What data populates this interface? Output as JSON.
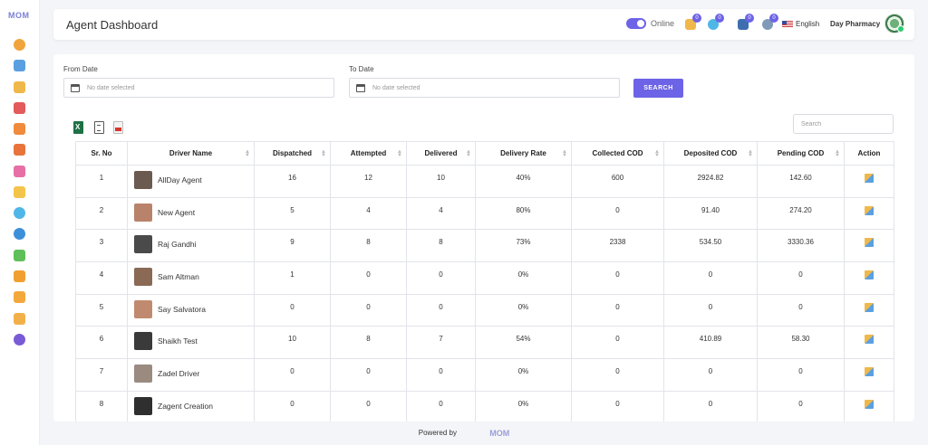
{
  "brand": "MOM",
  "sidebar": {
    "icons": [
      {
        "name": "dashboard-gauge-icon",
        "color": "#f1a43c"
      },
      {
        "name": "monitor-icon",
        "color": "#5aa0e0"
      },
      {
        "name": "box-icon",
        "color": "#f0b84a"
      },
      {
        "name": "ticket-icon",
        "color": "#e35b5b"
      },
      {
        "name": "hierarchy-icon",
        "color": "#f08a3c"
      },
      {
        "name": "agent-search-icon",
        "color": "#e8743b"
      },
      {
        "name": "grid-apps-icon",
        "color": "#e66fa6"
      },
      {
        "name": "table-icon",
        "color": "#f3c34a"
      },
      {
        "name": "chat-icon",
        "color": "#4fb6e8"
      },
      {
        "name": "globe-icon",
        "color": "#3d8fd9"
      },
      {
        "name": "wallet-icon",
        "color": "#5fbf5a"
      },
      {
        "name": "cart-icon",
        "color": "#f0a030"
      },
      {
        "name": "user-stack-icon",
        "color": "#f3a83c"
      },
      {
        "name": "package-icon",
        "color": "#f2b04a"
      },
      {
        "name": "globe-alt-icon",
        "color": "#7a5bd6"
      }
    ]
  },
  "header": {
    "title": "Agent Dashboard",
    "status_label": "Online",
    "badges": {
      "notifications": "0",
      "messages": "0",
      "orders": "0",
      "settings": "0"
    },
    "language": "English",
    "pharmacy": "Day Pharmacy",
    "accent": "#6c63e6"
  },
  "filters": {
    "from_label": "From Date",
    "to_label": "To Date",
    "from_placeholder": "No date selected",
    "to_placeholder": "No date selected",
    "search_button": "SEARCH",
    "table_search_placeholder": "Search"
  },
  "table": {
    "headers": [
      "Sr. No",
      "Driver Name",
      "Dispatched",
      "Attempted",
      "Delivered",
      "Delivery Rate",
      "Collected COD",
      "Deposited COD",
      "Pending COD",
      "Action"
    ],
    "rows": [
      {
        "sr": "1",
        "driver": "AllDay Agent",
        "dispatched": "16",
        "attempted": "12",
        "delivered": "10",
        "rate": "40%",
        "collected": "600",
        "deposited": "2924.82",
        "pending": "142.60",
        "avatar_color": "#6b5a50"
      },
      {
        "sr": "2",
        "driver": "New Agent",
        "dispatched": "5",
        "attempted": "4",
        "delivered": "4",
        "rate": "80%",
        "collected": "0",
        "deposited": "91.40",
        "pending": "274.20",
        "avatar_color": "#b9826a"
      },
      {
        "sr": "3",
        "driver": "Raj Gandhi",
        "dispatched": "9",
        "attempted": "8",
        "delivered": "8",
        "rate": "73%",
        "collected": "2338",
        "deposited": "534.50",
        "pending": "3330.36",
        "avatar_color": "#4a4a4a"
      },
      {
        "sr": "4",
        "driver": "Sam Altman",
        "dispatched": "1",
        "attempted": "0",
        "delivered": "0",
        "rate": "0%",
        "collected": "0",
        "deposited": "0",
        "pending": "0",
        "avatar_color": "#8a6a55"
      },
      {
        "sr": "5",
        "driver": "Say Salvatora",
        "dispatched": "0",
        "attempted": "0",
        "delivered": "0",
        "rate": "0%",
        "collected": "0",
        "deposited": "0",
        "pending": "0",
        "avatar_color": "#c08a70"
      },
      {
        "sr": "6",
        "driver": "Shaikh Test",
        "dispatched": "10",
        "attempted": "8",
        "delivered": "7",
        "rate": "54%",
        "collected": "0",
        "deposited": "410.89",
        "pending": "58.30",
        "avatar_color": "#3a3a3a"
      },
      {
        "sr": "7",
        "driver": "Zadel Driver",
        "dispatched": "0",
        "attempted": "0",
        "delivered": "0",
        "rate": "0%",
        "collected": "0",
        "deposited": "0",
        "pending": "0",
        "avatar_color": "#9a8a80"
      },
      {
        "sr": "8",
        "driver": "Zagent Creation",
        "dispatched": "0",
        "attempted": "0",
        "delivered": "0",
        "rate": "0%",
        "collected": "0",
        "deposited": "0",
        "pending": "0",
        "avatar_color": "#2f2f2f"
      }
    ]
  },
  "footer": {
    "powered_by": "Powered by",
    "logo": "MOM"
  }
}
